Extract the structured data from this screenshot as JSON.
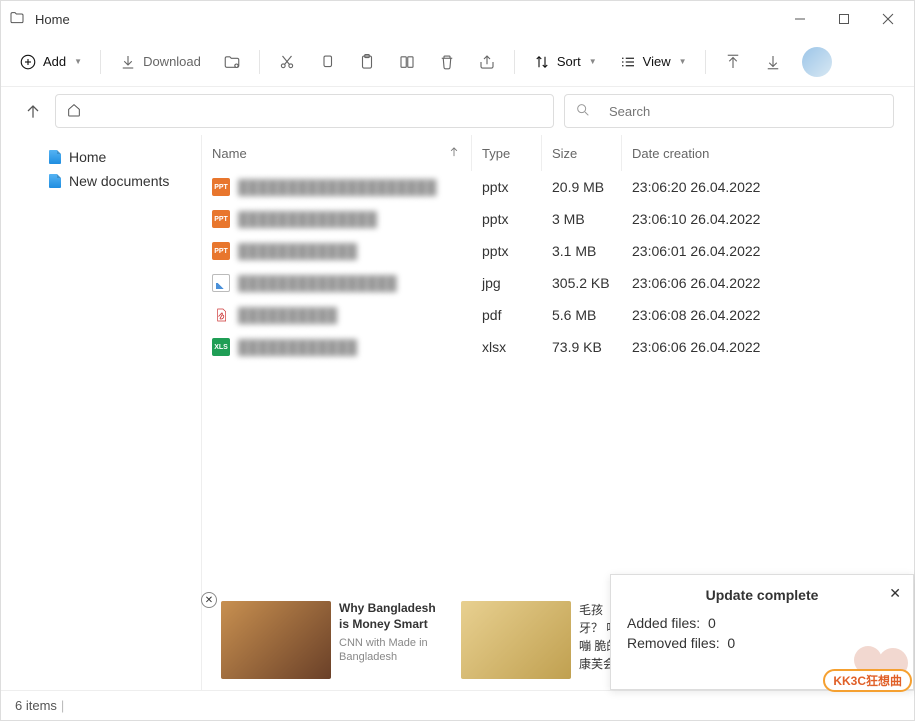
{
  "window": {
    "title": "Home"
  },
  "toolbar": {
    "add": "Add",
    "download": "Download",
    "sort": "Sort",
    "view": "View"
  },
  "search": {
    "placeholder": "Search"
  },
  "sidebar": {
    "items": [
      {
        "label": "Home"
      },
      {
        "label": "New documents"
      }
    ]
  },
  "columns": {
    "name": "Name",
    "type": "Type",
    "size": "Size",
    "date": "Date creation"
  },
  "files": [
    {
      "icon": "ppt",
      "name": "████████████████████",
      "type": "pptx",
      "size": "20.9 MB",
      "date": "23:06:20 26.04.2022"
    },
    {
      "icon": "ppt",
      "name": "██████████████",
      "type": "pptx",
      "size": "3 MB",
      "date": "23:06:10 26.04.2022"
    },
    {
      "icon": "ppt",
      "name": "████████████",
      "type": "pptx",
      "size": "3.1 MB",
      "date": "23:06:01 26.04.2022"
    },
    {
      "icon": "jpg",
      "name": "████████████████",
      "type": "jpg",
      "size": "305.2 KB",
      "date": "23:06:06 26.04.2022"
    },
    {
      "icon": "pdf",
      "name": "██████████",
      "type": "pdf",
      "size": "5.6 MB",
      "date": "23:06:08 26.04.2022"
    },
    {
      "icon": "xls",
      "name": "████████████",
      "type": "xlsx",
      "size": "73.9 KB",
      "date": "23:06:06 26.04.2022"
    }
  ],
  "status": {
    "items": "6 items"
  },
  "ads": {
    "a": {
      "title": "Why Bangladesh is Money Smart",
      "source": "CNN with Made in Bangladesh"
    },
    "b": {
      "text": "毛孩\n牙？\n嘎嘣\n脆的\n康芙会"
    }
  },
  "notif": {
    "title": "Update complete",
    "added_label": "Added files:",
    "added_value": "0",
    "removed_label": "Removed files:",
    "removed_value": "0"
  },
  "watermark": "KK3C狂想曲"
}
